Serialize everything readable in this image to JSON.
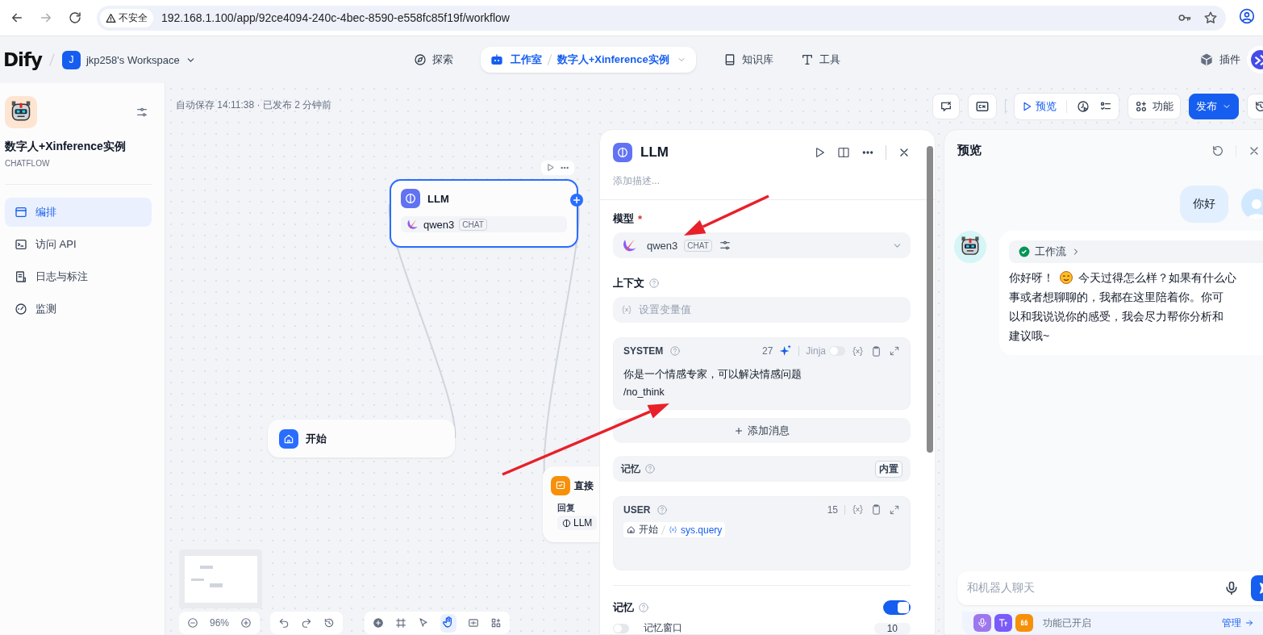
{
  "browser": {
    "security": "不安全",
    "url": "192.168.1.100/app/92ce4094-240c-4bec-8590-e558fc85f19f/workflow"
  },
  "header": {
    "logo": "Dify",
    "workspace_initial": "J",
    "workspace": "jkp258's Workspace",
    "nav": [
      {
        "kind": "explore",
        "label": "探索",
        "selected": false
      },
      {
        "kind": "studio",
        "label": "工作室",
        "app": "数字人+Xinference实例",
        "selected": true
      },
      {
        "kind": "knowledge",
        "label": "知识库",
        "selected": false
      },
      {
        "kind": "tools",
        "label": "工具",
        "selected": false
      }
    ],
    "plugins": "插件"
  },
  "sidebar": {
    "app_name": "数字人+Xinference实例",
    "app_type": "CHATFLOW",
    "items": [
      {
        "kind": "orchestrate",
        "label": "编排",
        "selected": true
      },
      {
        "kind": "api",
        "label": "访问 API",
        "selected": false
      },
      {
        "kind": "logs",
        "label": "日志与标注",
        "selected": false
      },
      {
        "kind": "monitor",
        "label": "监测",
        "selected": false
      }
    ]
  },
  "canvas": {
    "status": "自动保存 14:11:38 · 已发布 2 分钟前",
    "toolbar": {
      "preview": "预览",
      "features": "功能",
      "publish": "发布"
    },
    "nodes": [
      {
        "kind": "llm",
        "title": "LLM",
        "model": "qwen3",
        "mode": "CHAT",
        "selected": true
      },
      {
        "kind": "start",
        "title": "开始",
        "selected": false
      },
      {
        "kind": "answer",
        "title": "直接",
        "label": "回复",
        "ref": "LLM",
        "selected": false
      }
    ],
    "zoom": "96%"
  },
  "llm_panel": {
    "title": "LLM",
    "description_placeholder": "添加描述...",
    "model_label": "模型",
    "required_mark": "*",
    "model": "qwen3",
    "model_mode": "CHAT",
    "context_label": "上下文",
    "context_placeholder": "设置变量值",
    "system": {
      "role": "SYSTEM",
      "count": "27",
      "jinja": "Jinja",
      "jinja_on": false,
      "lines": [
        "你是一个情感专家，可以解决情感问题",
        "/no_think"
      ]
    },
    "add_message": "添加消息",
    "memory_row": {
      "label": "记忆",
      "badge": "内置"
    },
    "user": {
      "role": "USER",
      "count": "15",
      "node": "开始",
      "variable": "sys.query"
    },
    "memory": {
      "label": "记忆",
      "on": true
    },
    "memory_window": {
      "label": "记忆窗口",
      "on": false,
      "value": "10"
    }
  },
  "preview": {
    "title": "预览",
    "user_message": "你好",
    "workflow": "工作流",
    "reply_before": "你好呀！",
    "reply_lines": [
      "今天过得怎么样？如果有什么心",
      "事或者想聊聊的，我都在这里陪着你。你可",
      "以和我说说你的感受，我会尽力帮你分析和",
      "建议哦~"
    ],
    "input_placeholder": "和机器人聊天",
    "features_status": "功能已开启",
    "manage": "管理"
  }
}
